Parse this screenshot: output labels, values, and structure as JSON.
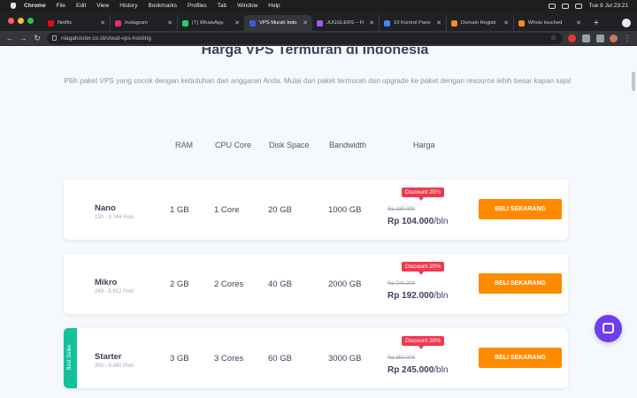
{
  "menubar": {
    "items": [
      "Chrome",
      "File",
      "Edit",
      "View",
      "History",
      "Bookmarks",
      "Profiles",
      "Tab",
      "Window",
      "Help"
    ],
    "datetime": "Tue 8 Jul  23:21"
  },
  "browser": {
    "tabs": [
      {
        "title": "Netflix",
        "icon_color": "#e50914",
        "active": false
      },
      {
        "title": "Instagram",
        "icon_color": "#e1306c",
        "active": false
      },
      {
        "title": "(7) WhatsApp",
        "icon_color": "#25d366",
        "active": false
      },
      {
        "title": "VPS Murah Indo",
        "icon_color": "#3b5bdb",
        "active": true
      },
      {
        "title": "JUGGLERS – Fi",
        "icon_color": "#a259ff",
        "active": false
      },
      {
        "title": "10 Kontrol Pane",
        "icon_color": "#4285f4",
        "active": false
      },
      {
        "title": "Domain Registr",
        "icon_color": "#f68b1f",
        "active": false
      },
      {
        "title": "Whois touched",
        "icon_color": "#f68b1f",
        "active": false
      }
    ],
    "url": "niagahoster.co.id/cloud-vps-hosting"
  },
  "page": {
    "heading": "Harga VPS Termurah di Indonesia",
    "subtitle": "Pilih paket VPS yang cocok dengan kebutuhan dan anggaran Anda. Mulai dari paket termurah dan upgrade ke paket dengan resource lebih besar kapan saja!",
    "columns": {
      "ram": "RAM",
      "cpu": "CPU Core",
      "disk": "Disk Space",
      "bandwidth": "Bandwidth",
      "price": "Harga"
    },
    "plans": [
      {
        "name": "Nano",
        "caption": "130 - 3.744 Poin",
        "ram": "1 GB",
        "cpu": "1 Core",
        "disk": "20 GB",
        "bandwidth": "1000 GB",
        "discount": "Discount 20%",
        "old_price": "Rp 130.000",
        "price": "Rp 104.000",
        "unit": "/bln",
        "button": "BELI SEKARANG"
      },
      {
        "name": "Mikro",
        "caption": "240 - 6.912 Poin",
        "ram": "2 GB",
        "cpu": "2 Cores",
        "disk": "40 GB",
        "bandwidth": "2000 GB",
        "discount": "Discount 20%",
        "old_price": "Rp 240.000",
        "price": "Rp 192.000",
        "unit": "/bln",
        "button": "BELI SEKARANG"
      },
      {
        "name": "Starter",
        "caption": "350 - 9.880 Poin",
        "ram": "3 GB",
        "cpu": "3 Cores",
        "disk": "60 GB",
        "bandwidth": "3000 GB",
        "discount": "Discount 30%",
        "old_price": "Rp 350.000",
        "price": "Rp 245.000",
        "unit": "/bln",
        "button": "BELI SEKARANG",
        "ribbon": "Best Seller"
      }
    ]
  },
  "colors": {
    "accent": "#ff8a00",
    "badge": "#f0394f",
    "ribbon": "#13c29b",
    "chat": "#6c3df1"
  }
}
